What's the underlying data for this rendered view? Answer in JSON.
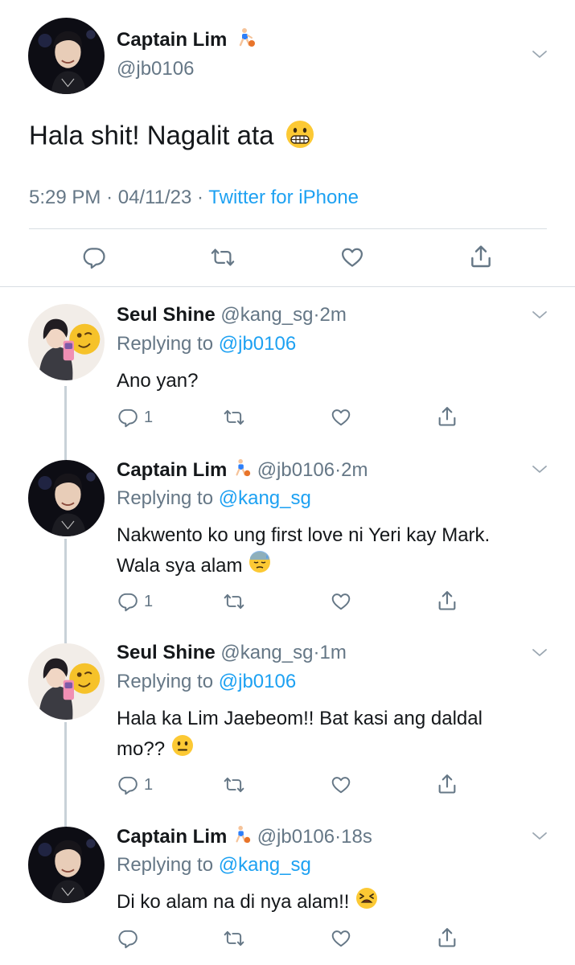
{
  "colors": {
    "link": "#1da1f2",
    "muted": "#657786",
    "divider": "#d8dee3",
    "thread": "#c8d1d8"
  },
  "main_tweet": {
    "name": "Captain Lim",
    "name_emoji": "person-bouncing-ball-emoji",
    "handle": "@jb0106",
    "text": "Hala shit! Nagalit ata",
    "text_emoji": "grimacing-face-emoji",
    "time": "5:29 PM",
    "date": "04/11/23",
    "source": "Twitter for iPhone",
    "separator": "·"
  },
  "replies": [
    {
      "name": "Seul Shine",
      "handle": "@kang_sg",
      "age": "2m",
      "replying_prefix": "Replying to",
      "replying_to": "@jb0106",
      "text": "Ano yan?",
      "reply_count": "1",
      "avatar": "avatar-seul"
    },
    {
      "name": "Captain Lim",
      "handle": "@jb0106",
      "age": "2m",
      "replying_prefix": "Replying to",
      "replying_to": "@kang_sg",
      "text": "Nakwento ko ung first love ni Yeri kay Mark. Wala sya alam",
      "text_emoji": "downcast-face-with-sweat-emoji",
      "reply_count": "1",
      "avatar": "avatar-lim"
    },
    {
      "name": "Seul Shine",
      "handle": "@kang_sg",
      "age": "1m",
      "replying_prefix": "Replying to",
      "replying_to": "@jb0106",
      "text": "Hala ka Lim Jaebeom!! Bat kasi ang daldal mo??",
      "text_emoji": "neutral-face-emoji",
      "reply_count": "1",
      "avatar": "avatar-seul"
    },
    {
      "name": "Captain Lim",
      "handle": "@jb0106",
      "age": "18s",
      "replying_prefix": "Replying to",
      "replying_to": "@kang_sg",
      "text": "Di ko alam na di nya alam!!",
      "text_emoji": "tired-face-emoji",
      "reply_count": "",
      "avatar": "avatar-lim"
    }
  ]
}
